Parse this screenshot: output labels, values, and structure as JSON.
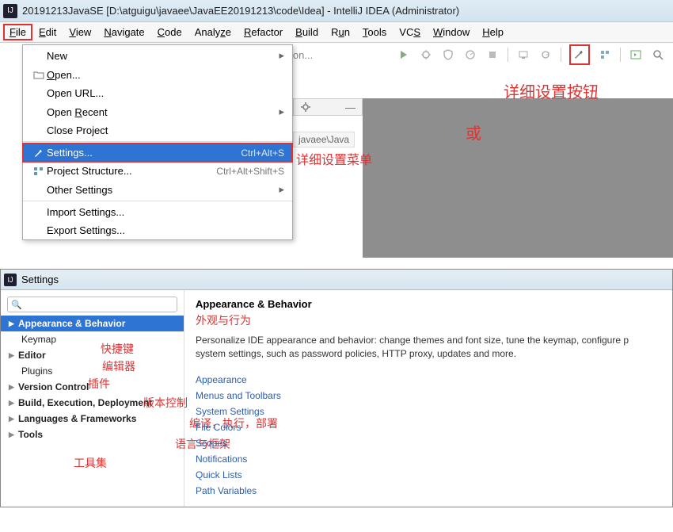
{
  "titlebar": {
    "icon_text": "IJ",
    "title": "20191213JavaSE [D:\\atguigu\\javaee\\JavaEE20191213\\code\\Idea] - IntelliJ IDEA (Administrator)"
  },
  "menubar": {
    "file": "File",
    "edit": "Edit",
    "view": "View",
    "navigate": "Navigate",
    "code": "Code",
    "analyze": "Analyze",
    "refactor": "Refactor",
    "build": "Build",
    "run": "Run",
    "tools": "Tools",
    "vcs": "VCS",
    "window": "Window",
    "help": "Help"
  },
  "toolbar_run_label": "ion...",
  "file_menu": {
    "new": "New",
    "open": "Open...",
    "open_url": "Open URL...",
    "open_recent": "Open Recent",
    "close_project": "Close Project",
    "settings": "Settings...",
    "settings_accel": "Ctrl+Alt+S",
    "project_structure": "Project Structure...",
    "project_structure_accel": "Ctrl+Alt+Shift+S",
    "other_settings": "Other Settings",
    "import_settings": "Import Settings...",
    "export_settings": "Export Settings..."
  },
  "editor_tab_fragment": "javaee\\Java",
  "annotations": {
    "settings_menu": "详细设置菜单",
    "or": "或",
    "settings_button": "详细设置按钮"
  },
  "settings_dialog": {
    "icon_text": "IJ",
    "title": "Settings",
    "search_placeholder": "Q-",
    "sidebar": {
      "appearance_behavior": "Appearance & Behavior",
      "keymap": "Keymap",
      "editor": "Editor",
      "plugins": "Plugins",
      "version_control": "Version Control",
      "build_exec_deploy": "Build, Execution, Deployment",
      "lang_frameworks": "Languages & Frameworks",
      "tools": "Tools"
    },
    "sidebar_annot": {
      "keymap": "快捷键",
      "editor": "编辑器",
      "plugins": "插件",
      "version_control": "版本控制",
      "build": "编译，执行，部署",
      "lang": "语言与框架",
      "tools": "工具集"
    },
    "main": {
      "heading": "Appearance & Behavior",
      "heading_annot": "外观与行为",
      "desc": "Personalize IDE appearance and behavior: change themes and font size, tune the keymap, configure p system settings, such as password policies, HTTP proxy, updates and more.",
      "links": {
        "appearance": "Appearance",
        "menus_toolbars": "Menus and Toolbars",
        "system_settings": "System Settings",
        "file_colors": "File Colors",
        "scopes": "Scopes",
        "notifications": "Notifications",
        "quick_lists": "Quick Lists",
        "path_variables": "Path Variables"
      }
    }
  }
}
